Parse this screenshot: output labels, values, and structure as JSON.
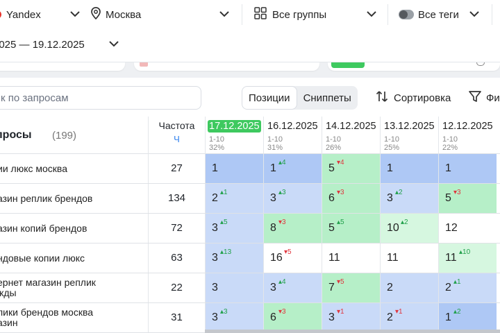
{
  "filters": {
    "engine": "Yandex",
    "region": "Москва",
    "groups": "Все группы",
    "tags": "Все теги",
    "period": "2025 — 19.12.2025"
  },
  "icons": [
    "engine-dot-icon",
    "chevron-down-icon",
    "location-pin-icon",
    "grid-icon",
    "toggle-icon",
    "sort-icon",
    "filter-icon"
  ],
  "colors": {
    "accent": "#3ec95f",
    "link": "#2f80ed",
    "cell_blue": "#c9daf8",
    "cell_blue_top": "#aec8f5",
    "cell_green": "#b6efc8",
    "cell_green_light": "#d6f7e0",
    "cell_white": "#ffffff",
    "up": "#20a04a",
    "down": "#e0353d"
  },
  "controls": {
    "search_placeholder": "к по запросам",
    "tabs": [
      "Позиции",
      "Сниппеты"
    ],
    "active_tab": "Позиции",
    "sort_label": "Сортировка",
    "filter_label": "Фи"
  },
  "table": {
    "queries_title": "просы",
    "queries_count": "(199)",
    "freq_header": "Частота",
    "freq_unit": "Ч",
    "dates": [
      {
        "date": "17.12.2025",
        "range": "1-10",
        "pct": "32%",
        "current": true
      },
      {
        "date": "16.12.2025",
        "range": "1-10",
        "pct": "31%",
        "current": false
      },
      {
        "date": "14.12.2025",
        "range": "1-10",
        "pct": "26%",
        "current": false
      },
      {
        "date": "13.12.2025",
        "range": "1-10",
        "pct": "25%",
        "current": false
      },
      {
        "date": "12.12.2025",
        "range": "1-10",
        "pct": "22%",
        "current": false
      }
    ],
    "rows": [
      {
        "query": "ии люкс москва",
        "freq": "27",
        "cells": [
          {
            "v": "1",
            "d": "",
            "dir": "",
            "bg": "cell_blue_top"
          },
          {
            "v": "1",
            "d": "4",
            "dir": "up",
            "bg": "cell_blue_top"
          },
          {
            "v": "5",
            "d": "4",
            "dir": "down",
            "bg": "cell_green"
          },
          {
            "v": "1",
            "d": "",
            "dir": "",
            "bg": "cell_blue_top"
          },
          {
            "v": "1",
            "d": "",
            "dir": "",
            "bg": "cell_blue_top"
          }
        ]
      },
      {
        "query": "азин реплик брендов",
        "freq": "134",
        "cells": [
          {
            "v": "2",
            "d": "1",
            "dir": "up",
            "bg": "cell_blue"
          },
          {
            "v": "3",
            "d": "3",
            "dir": "up",
            "bg": "cell_blue"
          },
          {
            "v": "6",
            "d": "3",
            "dir": "down",
            "bg": "cell_green"
          },
          {
            "v": "3",
            "d": "2",
            "dir": "up",
            "bg": "cell_blue"
          },
          {
            "v": "5",
            "d": "3",
            "dir": "down",
            "bg": "cell_green"
          }
        ]
      },
      {
        "query": "азин копий брендов",
        "freq": "72",
        "cells": [
          {
            "v": "3",
            "d": "5",
            "dir": "up",
            "bg": "cell_blue"
          },
          {
            "v": "8",
            "d": "3",
            "dir": "down",
            "bg": "cell_green"
          },
          {
            "v": "5",
            "d": "5",
            "dir": "up",
            "bg": "cell_green"
          },
          {
            "v": "10",
            "d": "2",
            "dir": "up",
            "bg": "cell_green_light"
          },
          {
            "v": "12",
            "d": "",
            "dir": "",
            "bg": "cell_white"
          }
        ]
      },
      {
        "query": "ндовые копии люкс",
        "freq": "63",
        "cells": [
          {
            "v": "3",
            "d": "13",
            "dir": "up",
            "bg": "cell_blue"
          },
          {
            "v": "16",
            "d": "5",
            "dir": "down",
            "bg": "cell_white"
          },
          {
            "v": "11",
            "d": "",
            "dir": "",
            "bg": "cell_white"
          },
          {
            "v": "11",
            "d": "",
            "dir": "",
            "bg": "cell_white"
          },
          {
            "v": "11",
            "d": "10",
            "dir": "up",
            "bg": "cell_green_light"
          }
        ]
      },
      {
        "query": "ернет магазин реплик\nжды",
        "freq": "22",
        "cells": [
          {
            "v": "3",
            "d": "",
            "dir": "",
            "bg": "cell_blue"
          },
          {
            "v": "3",
            "d": "4",
            "dir": "up",
            "bg": "cell_blue"
          },
          {
            "v": "7",
            "d": "5",
            "dir": "down",
            "bg": "cell_green"
          },
          {
            "v": "2",
            "d": "",
            "dir": "",
            "bg": "cell_blue"
          },
          {
            "v": "2",
            "d": "1",
            "dir": "up",
            "bg": "cell_blue"
          }
        ]
      },
      {
        "query": "лики брендов москва\nазин",
        "freq": "31",
        "cells": [
          {
            "v": "3",
            "d": "3",
            "dir": "up",
            "bg": "cell_blue"
          },
          {
            "v": "6",
            "d": "3",
            "dir": "down",
            "bg": "cell_green"
          },
          {
            "v": "3",
            "d": "1",
            "dir": "down",
            "bg": "cell_blue"
          },
          {
            "v": "2",
            "d": "1",
            "dir": "down",
            "bg": "cell_blue"
          },
          {
            "v": "1",
            "d": "2",
            "dir": "up",
            "bg": "cell_blue_top"
          }
        ]
      }
    ]
  }
}
